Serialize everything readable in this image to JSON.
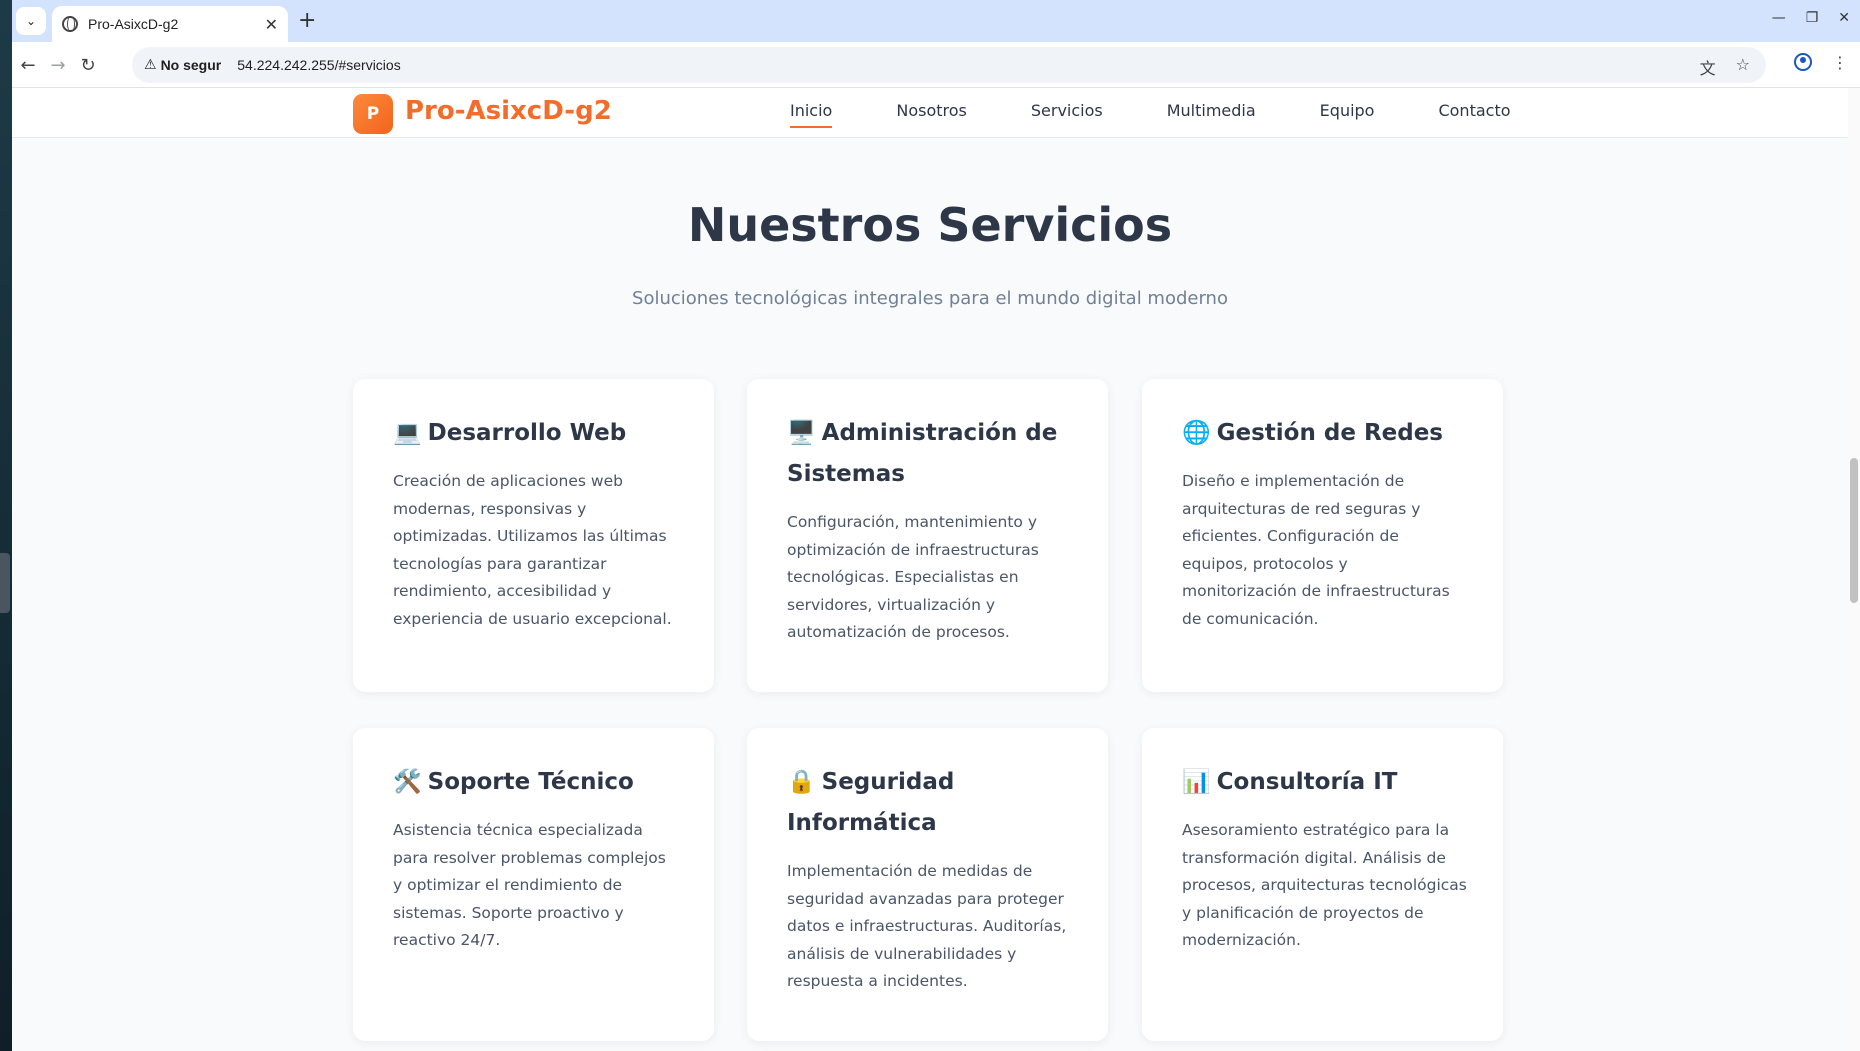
{
  "browser": {
    "tab_title": "Pro-AsixcD-g2",
    "not_secure_label": "No segur",
    "url": "54.224.242.255/#servicios"
  },
  "site": {
    "logo_letter": "P",
    "brand": "Pro-AsixcD-g2",
    "nav": [
      "Inicio",
      "Nosotros",
      "Servicios",
      "Multimedia",
      "Equipo",
      "Contacto"
    ],
    "active_nav": "Inicio"
  },
  "services": {
    "title": "Nuestros Servicios",
    "subtitle": "Soluciones tecnológicas integrales para el mundo digital moderno",
    "cards": [
      {
        "emoji": "💻",
        "title": "Desarrollo Web",
        "text": "Creación de aplicaciones web modernas, responsivas y optimizadas. Utilizamos las últimas tecnologías para garantizar rendimiento, accesibilidad y experiencia de usuario excepcional."
      },
      {
        "emoji": "🖥️",
        "title": "Administración de Sistemas",
        "text": "Configuración, mantenimiento y optimización de infraestructuras tecnológicas. Especialistas en servidores, virtualización y automatización de procesos."
      },
      {
        "emoji": "🌐",
        "title": "Gestión de Redes",
        "text": "Diseño e implementación de arquitecturas de red seguras y eficientes. Configuración de equipos, protocolos y monitorización de infraestructuras de comunicación."
      },
      {
        "emoji": "🛠️",
        "title": "Soporte Técnico",
        "text": "Asistencia técnica especializada para resolver problemas complejos y optimizar el rendimiento de sistemas. Soporte proactivo y reactivo 24/7."
      },
      {
        "emoji": "🔒",
        "title": "Seguridad Informática",
        "text": "Implementación de medidas de seguridad avanzadas para proteger datos e infraestructuras. Auditorías, análisis de vulnerabilidades y respuesta a incidentes."
      },
      {
        "emoji": "📊",
        "title": "Consultoría IT",
        "text": "Asesoramiento estratégico para la transformación digital. Análisis de procesos, arquitecturas tecnológicas y planificación de proyectos de modernización."
      }
    ]
  },
  "colors": {
    "accent": "#f26c2a",
    "heading": "#2d3748",
    "body_text": "#4a5568",
    "subtitle": "#718096",
    "page_bg": "#f9fafb",
    "tabstrip_bg": "#d3e3fd"
  }
}
